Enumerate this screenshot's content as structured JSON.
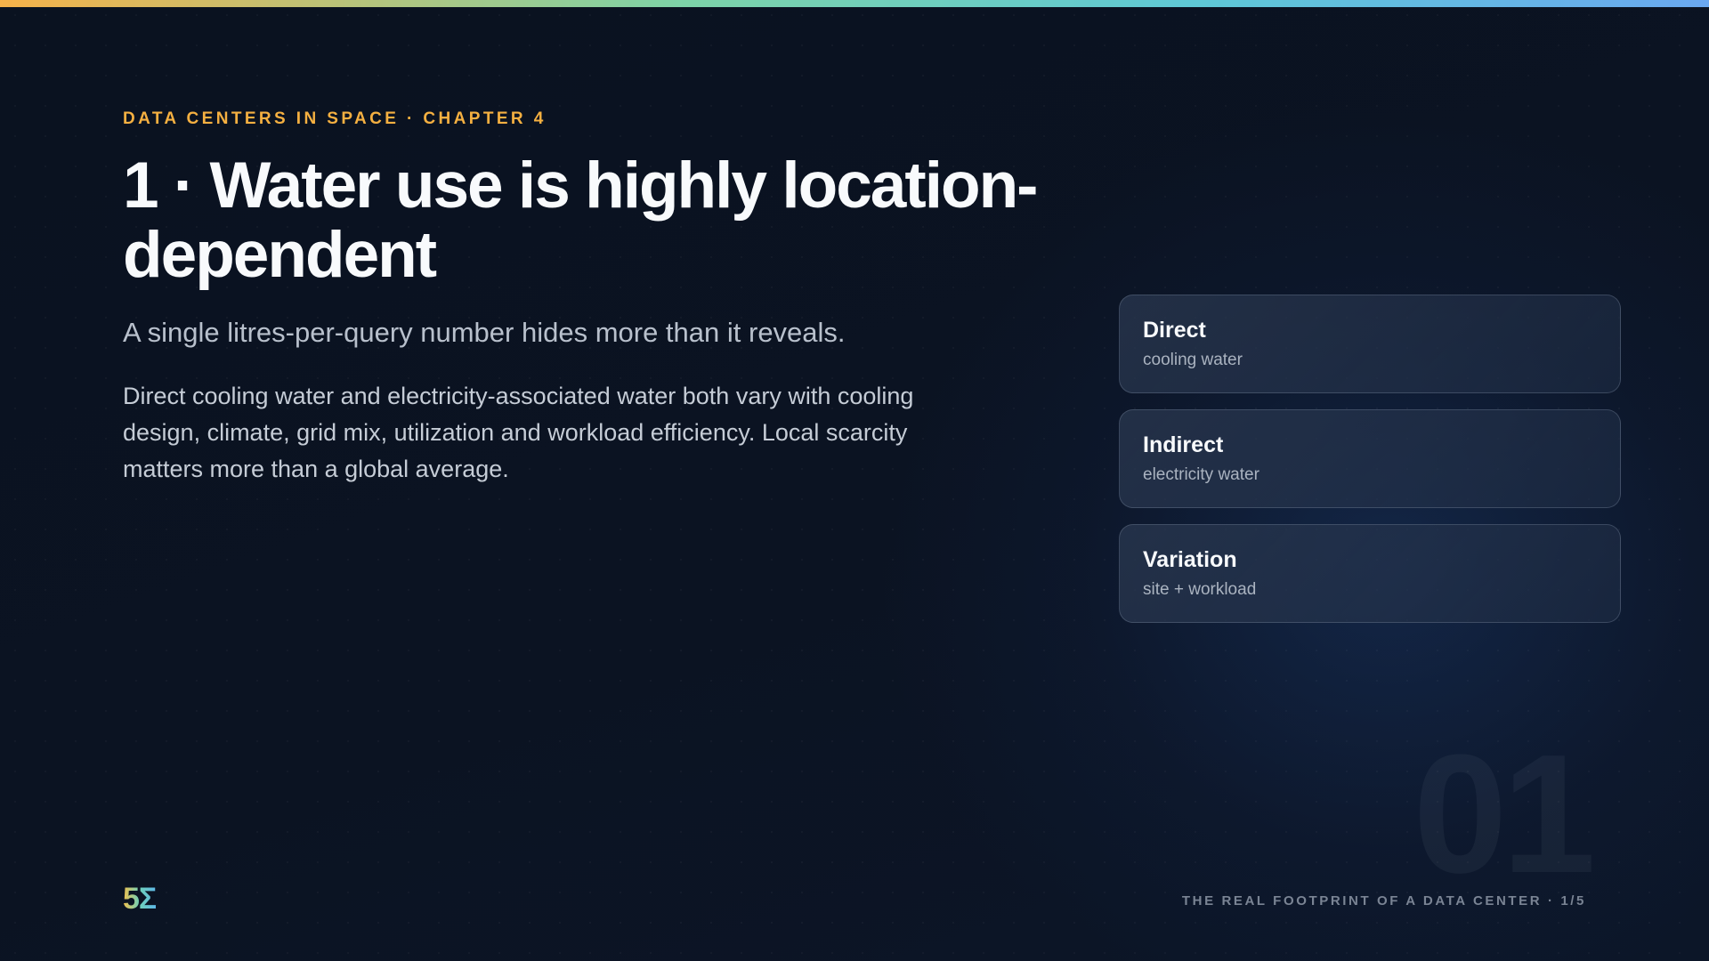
{
  "slide": {
    "eyebrow": "DATA CENTERS IN SPACE · CHAPTER 4",
    "title": "1 · Water use is highly location-dependent",
    "subtitle": "A single litres-per-query number hides more than it reveals.",
    "body": "Direct cooling water and electricity-associated water both vary with cooling design, climate, grid mix, utilization and workload efficiency. Local scarcity matters more than a global average.",
    "cards": [
      {
        "title": "Direct",
        "subtitle": "cooling water"
      },
      {
        "title": "Indirect",
        "subtitle": "electricity water"
      },
      {
        "title": "Variation",
        "subtitle": "site + workload"
      }
    ],
    "big_number": "01",
    "logo_text": "5Σ",
    "footer": "THE REAL FOOTPRINT OF A DATA CENTER · 1/5"
  },
  "colors": {
    "accent": "#f5b041",
    "background": "#0b1220",
    "card_border": "#3a4760",
    "gradient_start": "#f6b24a",
    "gradient_end": "#6aa8f0"
  }
}
